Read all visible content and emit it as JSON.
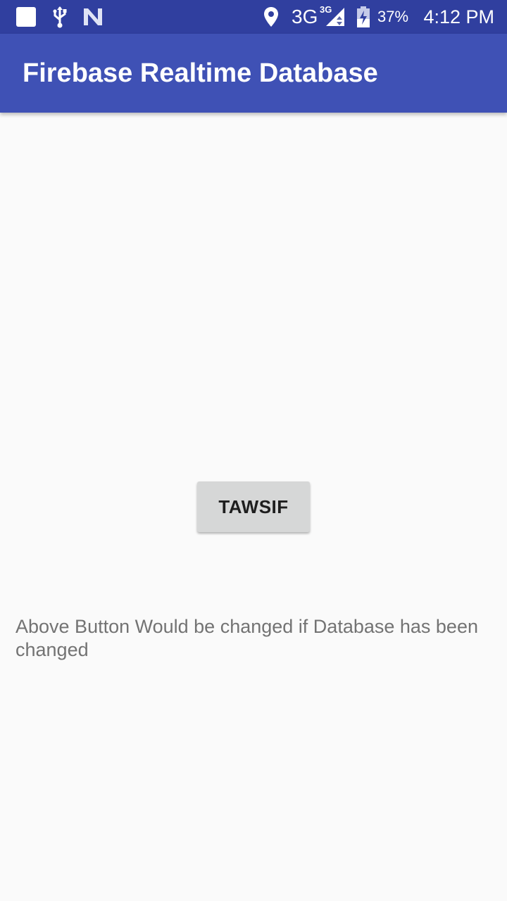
{
  "status_bar": {
    "network_type": "3G",
    "network_type_sup": "3G",
    "battery_percent": "37%",
    "time": "4:12 PM",
    "icons": [
      "notification-square-icon",
      "usb-icon",
      "n-icon",
      "location-icon",
      "signal-icon",
      "battery-icon"
    ]
  },
  "app_bar": {
    "title": "Firebase Realtime Database",
    "color": "#3f51b5"
  },
  "main": {
    "button_label": "TAWSIF",
    "info_text": "Above Button Would be changed if Database has been changed"
  },
  "colors": {
    "status_bar": "#303f9f",
    "app_bar": "#3f51b5",
    "background": "#fafafa",
    "button": "#d6d7d7"
  }
}
